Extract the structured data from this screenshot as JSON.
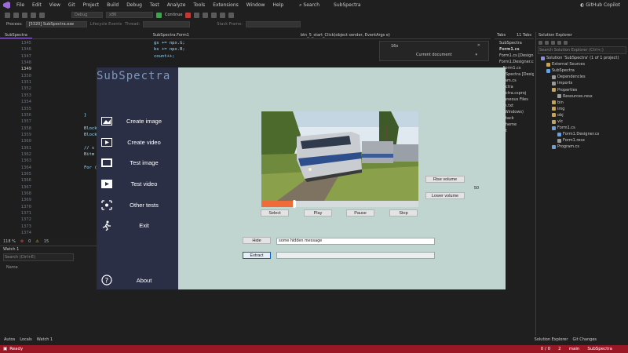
{
  "menu": [
    "File",
    "Edit",
    "View",
    "Git",
    "Project",
    "Build",
    "Debug",
    "Test",
    "Analyze",
    "Tools",
    "Extensions",
    "Window",
    "Help"
  ],
  "search_label": "Search",
  "solution_name": "SubSpectra",
  "toolbar": {
    "config": "Debug",
    "platform": "x86",
    "continue": "Continue",
    "copilot": "GitHub Copilot"
  },
  "process": {
    "label": "Process:",
    "value": "[5320] SubSpectra.exe",
    "lifecycle": "Lifecycle Events",
    "thread": "Thread:",
    "stack": "Stack Frame:"
  },
  "tabs": {
    "project": "SubSpectra",
    "form": "SubSpectra.Form1",
    "method": "btn_5_start_Click(object sender, EventArgs e)",
    "tabs_title": "Tabs",
    "tabs_count": "11 Tabs"
  },
  "find": {
    "zoom": "16x",
    "scope": "Current document"
  },
  "code_lines": [
    {
      "n": "1345",
      "code": "gs += npx.G;"
    },
    {
      "n": "1346",
      "code": "bs += npx.B;"
    },
    {
      "n": "1347",
      "code": "count++;"
    },
    {
      "n": "1348",
      "code": ""
    },
    {
      "n": "1349",
      "code": ""
    },
    {
      "n": "1350",
      "code": ""
    },
    {
      "n": "1351",
      "code": ""
    },
    {
      "n": "1352",
      "code": ""
    },
    {
      "n": "1353",
      "code": ""
    },
    {
      "n": "1354",
      "code": ""
    },
    {
      "n": "1355",
      "code": ""
    },
    {
      "n": "1356",
      "code": "}"
    },
    {
      "n": "1357",
      "code": ""
    },
    {
      "n": "1358",
      "code": "Block"
    },
    {
      "n": "1359",
      "code": "Block"
    },
    {
      "n": "1360",
      "code": ""
    },
    {
      "n": "1361",
      "code": "// s"
    },
    {
      "n": "1362",
      "code": "Bitm"
    },
    {
      "n": "1363",
      "code": ""
    },
    {
      "n": "1364",
      "code": "For ("
    },
    {
      "n": "1365",
      "code": ""
    },
    {
      "n": "1366",
      "code": ""
    },
    {
      "n": "1367",
      "code": ""
    },
    {
      "n": "1368",
      "code": ""
    },
    {
      "n": "1369",
      "code": ""
    },
    {
      "n": "1370",
      "code": ""
    },
    {
      "n": "1371",
      "code": ""
    },
    {
      "n": "1372",
      "code": ""
    },
    {
      "n": "1373",
      "code": ""
    },
    {
      "n": "1374",
      "code": ""
    }
  ],
  "editor_status": {
    "zoom": "118 %",
    "errors": "0",
    "warnings": "15"
  },
  "watch": {
    "title": "Watch 1",
    "search": "Search (Ctrl+E)",
    "col_name": "Name"
  },
  "bottom_tabs": [
    "Autos",
    "Locals",
    "Watch 1"
  ],
  "right_bottom_tabs": [
    "Solution Explorer",
    "Git Changes"
  ],
  "status": {
    "ready": "Ready",
    "position": "0 / 0",
    "changes": "2",
    "branch": "main",
    "repo": "SubSpectra"
  },
  "tabs_list": [
    "SubSpectra",
    "Form1.cs",
    "Form1.cs [Design]",
    "Form1.Designer.cs",
    "...Form1.cs",
    "...bSpectra [Design]",
    "...ram.cs",
    "...ectra",
    "...ectra.csproj",
    "...laneous Files",
    "...m.txt",
    "...(Windows)",
    "...Stack",
    "...Theme",
    "...ot"
  ],
  "solution_explorer": {
    "title": "Solution Explorer",
    "search": "Search Solution Explorer (Ctrl+;)",
    "items": [
      {
        "label": "Solution 'SubSpectra' (1 of 1 project)",
        "indent": 0,
        "color": "#8f8fd6"
      },
      {
        "label": "External Sources",
        "indent": 1,
        "color": "#c5a35a"
      },
      {
        "label": "SubSpectra",
        "indent": 1,
        "color": "#68a0e0"
      },
      {
        "label": "Dependencies",
        "indent": 2,
        "color": "#9a9a9a"
      },
      {
        "label": "Imports",
        "indent": 2,
        "color": "#9a9a9a"
      },
      {
        "label": "Properties",
        "indent": 2,
        "color": "#c5a35a"
      },
      {
        "label": "Resources.resx",
        "indent": 3,
        "color": "#9a9a9a"
      },
      {
        "label": "bin",
        "indent": 2,
        "color": "#c5a35a"
      },
      {
        "label": "img",
        "indent": 2,
        "color": "#c5a35a"
      },
      {
        "label": "obj",
        "indent": 2,
        "color": "#c5a35a"
      },
      {
        "label": "vlc",
        "indent": 2,
        "color": "#c5a35a"
      },
      {
        "label": "Form1.cs",
        "indent": 2,
        "color": "#68a0e0"
      },
      {
        "label": "Form1.Designer.cs",
        "indent": 3,
        "color": "#68a0e0"
      },
      {
        "label": "Form1.resx",
        "indent": 3,
        "color": "#9a9a9a"
      },
      {
        "label": "Program.cs",
        "indent": 2,
        "color": "#68a0e0"
      }
    ]
  },
  "app": {
    "title": "SubSpectra",
    "nav": [
      {
        "label": "Create image",
        "icon": "image-icon"
      },
      {
        "label": "Create video",
        "icon": "video-icon"
      },
      {
        "label": "Test image",
        "icon": "test-image-icon"
      },
      {
        "label": "Test video",
        "icon": "test-video-icon"
      },
      {
        "label": "Other tests",
        "icon": "tests-icon"
      },
      {
        "label": "Exit",
        "icon": "exit-icon"
      },
      {
        "label": "About",
        "icon": "help-icon"
      }
    ],
    "progress": 0.21,
    "buttons": {
      "select": "Select",
      "play": "Play",
      "pause": "Pause",
      "stop": "Stop",
      "raise": "Rise volume",
      "lower": "Lower volume",
      "hide": "Hide",
      "extract": "Extract"
    },
    "volume": "50",
    "message": "some hidden message",
    "extracted": "",
    "colors": {
      "sidebar": "#2b2f45",
      "content": "#c0d4d0",
      "progress": "#f06b3a",
      "status_bar": "#9a1826"
    }
  }
}
